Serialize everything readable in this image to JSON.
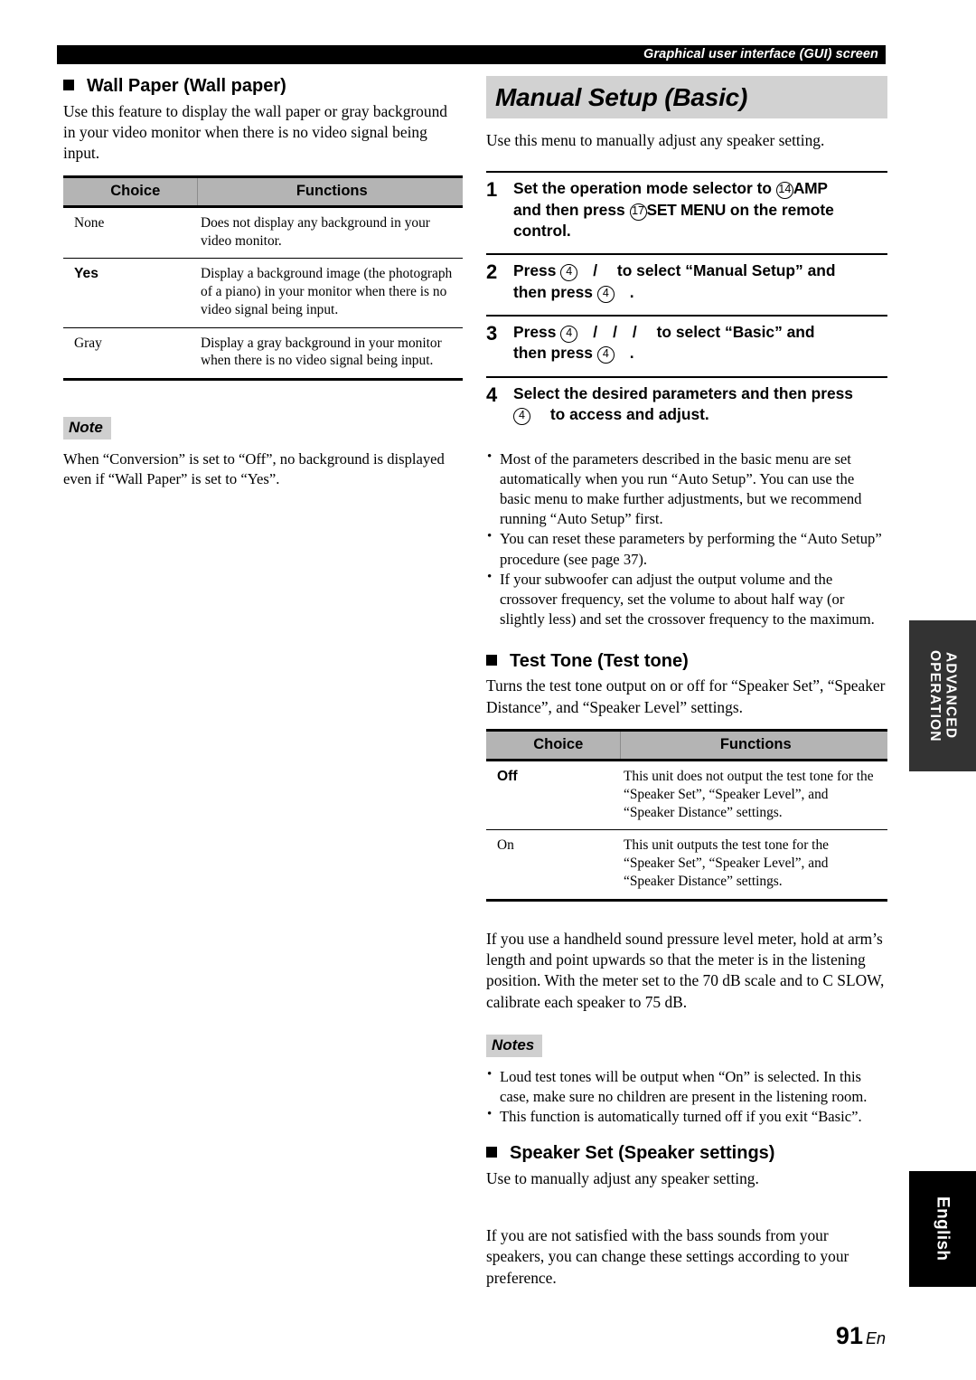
{
  "header": {
    "running_head": "Graphical user interface (GUI) screen"
  },
  "left_column": {
    "wall_paper": {
      "heading": "Wall Paper (Wall paper)",
      "intro": "Use this feature to display the wall paper or gray background in your video monitor when there is no video signal being input.",
      "table": {
        "columns": [
          "Choice",
          "Functions"
        ],
        "rows": [
          {
            "choice": "None",
            "bold": false,
            "function": "Does not display any background in your video monitor."
          },
          {
            "choice": "Yes",
            "bold": true,
            "function": "Display a background image (the photograph of a piano) in your monitor when there is no video signal being input."
          },
          {
            "choice": "Gray",
            "bold": false,
            "function": "Display a gray background in your monitor when there is no video signal being input."
          }
        ]
      }
    },
    "note": {
      "label": "Note",
      "text": "When “Conversion” is set to “Off”, no background is displayed even if “Wall Paper” is set to “Yes”."
    }
  },
  "right_column": {
    "banner_title": "Manual Setup (Basic)",
    "banner_intro": "Use this menu to manually adjust any speaker setting.",
    "steps": [
      {
        "num": "1",
        "line1_a": "Set the operation mode selector to",
        "circ1": "14",
        "key1": "AMP",
        "line2_a": "and then press",
        "circ2": "17",
        "key2": "SET MENU",
        "line2_b": "on the remote",
        "line3": "control."
      },
      {
        "num": "2",
        "line1_a": "Press",
        "circ1": "4",
        "sep1": "/",
        "line1_b": "to select “Manual Setup” and",
        "line2_a": "then press",
        "circ2": "4",
        "line2_b": "."
      },
      {
        "num": "3",
        "line1_a": "Press",
        "circ1": "4",
        "sep1": "/",
        "sep2": "/",
        "sep3": "/",
        "line1_b": "to select “Basic” and",
        "line2_a": "then press",
        "circ2": "4",
        "line2_b": "."
      },
      {
        "num": "4",
        "line1_a": "Select the desired parameters and then press",
        "circ1": "4",
        "line2_b": "to access and adjust."
      }
    ],
    "step_notes": [
      "Most of the parameters described in the basic menu are set automatically when you run “Auto Setup”. You can use the basic menu to make further adjustments, but we recommend running “Auto Setup” first.",
      "You can reset these parameters by performing the “Auto Setup” procedure (see page 37).",
      "If your subwoofer can adjust the output volume and the crossover frequency, set the volume to about half way (or slightly less) and set the crossover frequency to the maximum."
    ],
    "test_tone": {
      "heading": "Test Tone (Test tone)",
      "intro": "Turns the test tone output on or off for “Speaker Set”, “Speaker Distance”, and “Speaker Level” settings.",
      "table": {
        "columns": [
          "Choice",
          "Functions"
        ],
        "rows": [
          {
            "choice": "Off",
            "bold": true,
            "function": "This unit does not output the test tone for the “Speaker Set”, “Speaker Level”, and “Speaker Distance” settings."
          },
          {
            "choice": "On",
            "bold": false,
            "function": "This unit outputs the test tone for the “Speaker Set”, “Speaker Level”, and “Speaker Distance” settings."
          }
        ]
      },
      "after_table": "If you use a handheld sound pressure level meter, hold at arm’s length and point upwards so that the meter is in the listening position. With the meter set to the 70 dB scale and to C SLOW, calibrate each speaker to 75 dB.",
      "notes_label": "Notes",
      "notes": [
        "Loud test tones will be output when “On” is selected. In this case, make sure no children are present in the listening room.",
        "This function is automatically turned off if you exit “Basic”."
      ]
    },
    "speaker_set": {
      "heading": "Speaker Set (Speaker settings)",
      "intro": "Use to manually adjust any speaker setting.",
      "body": "If you are not satisfied with the bass sounds from your speakers, you can change these settings according to your preference."
    }
  },
  "side_tabs": {
    "advanced": "ADVANCED\nOPERATION",
    "language": "English"
  },
  "footer": {
    "page_number": "91",
    "language_code": "En"
  }
}
